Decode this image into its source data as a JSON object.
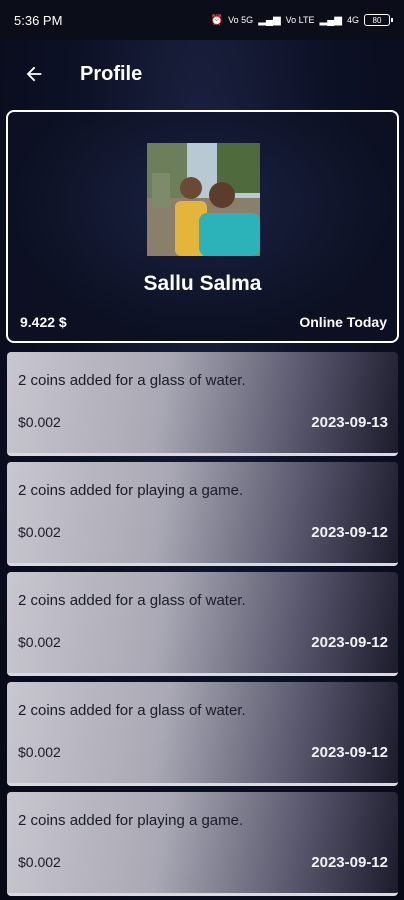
{
  "status_bar": {
    "time": "5:36 PM",
    "indicators": [
      "Vo 5G",
      "Vo LTE",
      "4G"
    ],
    "battery": "80"
  },
  "app_bar": {
    "back_icon": "arrow-left-icon",
    "title": "Profile"
  },
  "profile": {
    "name": "Sallu Salma",
    "balance": "9.422 $",
    "status": "Online Today"
  },
  "transactions": [
    {
      "description": "2 coins added for a glass of water.",
      "amount": "$0.002",
      "date": "2023-09-13"
    },
    {
      "description": "2 coins added for playing a game.",
      "amount": "$0.002",
      "date": "2023-09-12"
    },
    {
      "description": "2 coins added for a glass of water.",
      "amount": "$0.002",
      "date": "2023-09-12"
    },
    {
      "description": "2 coins added for a glass of water.",
      "amount": "$0.002",
      "date": "2023-09-12"
    },
    {
      "description": "2 coins added for playing a game.",
      "amount": "$0.002",
      "date": "2023-09-12"
    }
  ],
  "colors": {
    "background": "#0d1126",
    "card_border": "#ffffff",
    "tx_card_light": "#c8c7cf",
    "tx_card_dark": "#1c1b2c"
  }
}
